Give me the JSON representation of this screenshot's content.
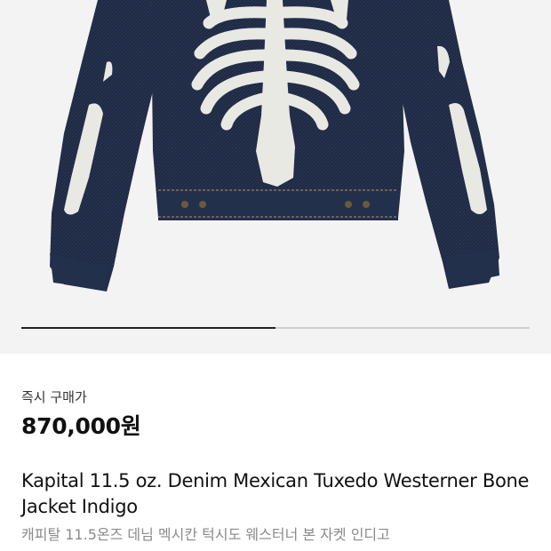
{
  "product": {
    "image_alt": "Kapital denim jacket with bone print",
    "carousel_progress": 0.5
  },
  "price": {
    "label": "즉시 구매가",
    "value": "870,000원"
  },
  "title": {
    "english": "Kapital 11.5 oz. Denim Mexican Tuxedo Westerner Bone Jacket Indigo",
    "korean": "캐피탈 11.5온즈 데님 멕시칸 턱시도 웨스터너 본 자켓 인디고"
  },
  "colors": {
    "denim": "#1f2a44",
    "bone": "#e9e9e4",
    "background": "#f3f3f3"
  }
}
